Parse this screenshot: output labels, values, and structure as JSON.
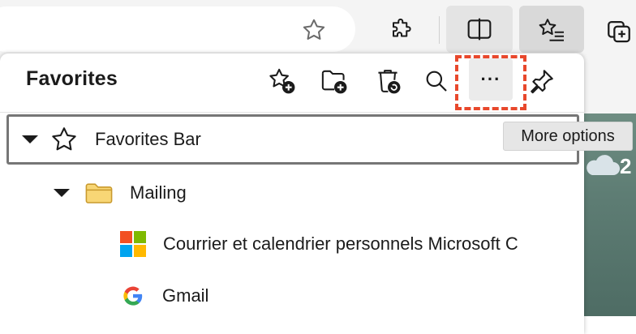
{
  "toolbar": {
    "address_star": "star-outline-icon",
    "extensions": "puzzle-icon",
    "split_screen": "split-screen-icon",
    "favorites": "favorites-list-icon",
    "collections": "add-collection-icon"
  },
  "panel": {
    "title": "Favorites",
    "header_buttons": [
      "add-favorite-icon",
      "add-folder-icon",
      "recently-deleted-icon",
      "search-icon",
      "more-options-icon",
      "pin-icon"
    ],
    "more_label": "···"
  },
  "tree": {
    "favorites_bar": "Favorites Bar",
    "mailing": "Mailing",
    "outlook": "Courrier et calendrier personnels Microsoft C",
    "gmail": "Gmail"
  },
  "tooltip": "More options",
  "background": {
    "weather_digit": "2"
  },
  "colors": {
    "highlight": "#e8482c",
    "folder": "#f3c14b"
  }
}
